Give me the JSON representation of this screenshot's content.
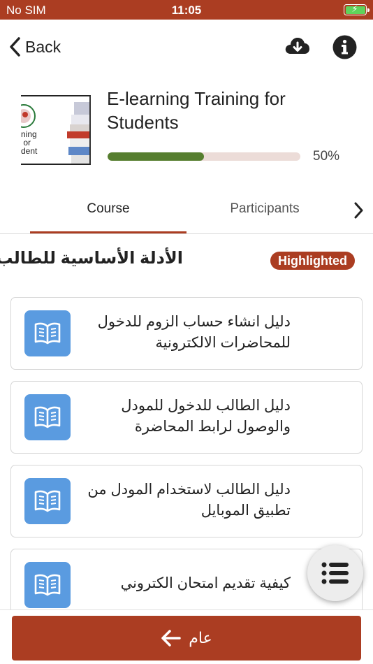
{
  "status_bar": {
    "carrier": "No SIM",
    "time": "11:05",
    "battery_icon": "battery-charging-icon"
  },
  "nav": {
    "back_label": "Back",
    "download_icon": "cloud-download-icon",
    "info_icon": "info-icon"
  },
  "course": {
    "title": "E-learning Training for Students",
    "thumbnail_text": "ning\nor\ndent",
    "progress_percent": 50,
    "progress_label": "50%"
  },
  "tabs": [
    {
      "label": "Course",
      "active": true
    },
    {
      "label": "Participants",
      "active": false
    }
  ],
  "section": {
    "title": "الأدلة الأساسية للطالب",
    "badge": "Highlighted"
  },
  "modules": [
    {
      "title": "دليل انشاء حساب الزوم للدخول للمحاضرات الالكترونية",
      "icon": "book-icon"
    },
    {
      "title": "دليل الطالب للدخول للمودل والوصول لرابط المحاضرة",
      "icon": "book-icon"
    },
    {
      "title": "دليل الطالب لاستخدام المودل من تطبيق الموبايل",
      "icon": "book-icon"
    },
    {
      "title": "كيفية تقديم امتحان الكتروني",
      "icon": "book-icon"
    }
  ],
  "fab": {
    "icon": "course-index-list-icon"
  },
  "bottom": {
    "label": "عام",
    "icon": "arrow-left-icon"
  },
  "colors": {
    "primary": "#ab3d22",
    "progress": "#567e2f",
    "module_icon_bg": "#5a9be0"
  }
}
